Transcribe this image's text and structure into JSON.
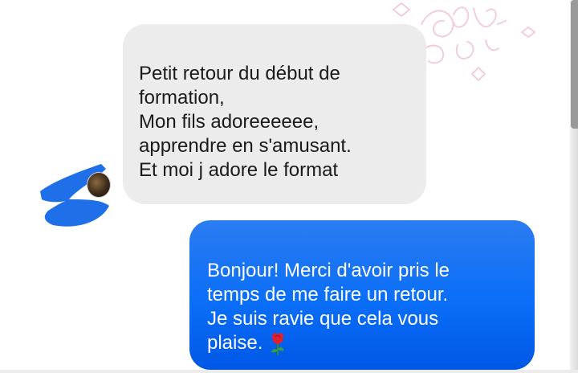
{
  "conversation": {
    "received": {
      "text": "Petit retour du début de\nformation,\nMon fils adoreeeeee,\napprendre en s'amusant.\nEt moi j adore le format"
    },
    "sent": {
      "text": "Bonjour! Merci d'avoir pris le\ntemps de me faire un retour.\nJe suis ravie que cela vous\nplaise.",
      "emoji": "rose-icon"
    }
  },
  "colors": {
    "received_bubble": "#ececec",
    "sent_bubble": "#0a6ef8",
    "redaction": "#1f6fe8"
  }
}
